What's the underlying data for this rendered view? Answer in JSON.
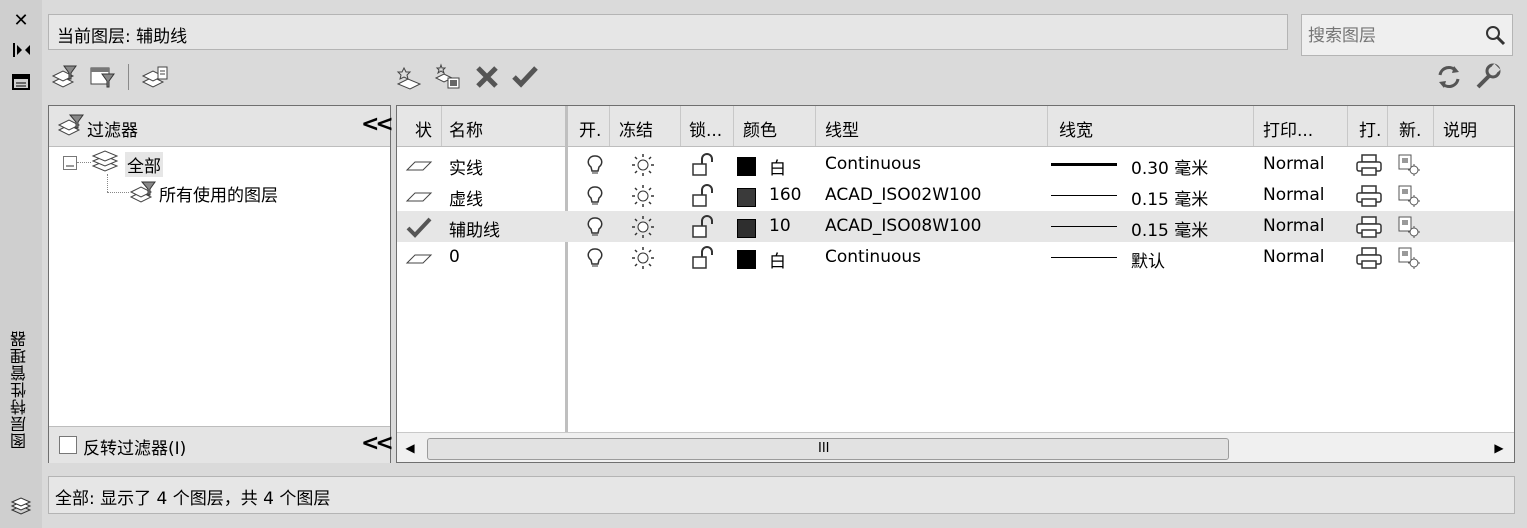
{
  "sidebar": {
    "title": "图层特性管理器",
    "close_icon": "close-icon",
    "autohide_icon": "autohide-icon",
    "properties_icon": "properties-icon",
    "layers_icon": "layers-icon"
  },
  "header": {
    "current_layer_label": "当前图层: 辅助线",
    "search_placeholder": "搜索图层"
  },
  "filter_panel": {
    "title": "过滤器",
    "tree": {
      "root": "全部",
      "child": "所有使用的图层"
    },
    "invert_label": "反转过滤器(I)",
    "invert_checked": false
  },
  "layer_table": {
    "columns": [
      "状",
      "名称",
      "开.",
      "冻结",
      "锁...",
      "颜色",
      "线型",
      "线宽",
      "打印...",
      "打.",
      "新.",
      "说明"
    ],
    "rows": [
      {
        "status": "layer",
        "name": "实线",
        "on": true,
        "frozen": false,
        "locked": false,
        "color_swatch": "#000000",
        "color": "白",
        "linetype": "Continuous",
        "lineweight": "0.30 毫米",
        "plot_style": "Normal"
      },
      {
        "status": "layer",
        "name": "虚线",
        "on": true,
        "frozen": false,
        "locked": false,
        "color_swatch": "#3a3a3a",
        "color": "160",
        "linetype": "ACAD_ISO02W100",
        "lineweight": "0.15 毫米",
        "plot_style": "Normal"
      },
      {
        "status": "current",
        "name": "辅助线",
        "on": true,
        "frozen": false,
        "locked": false,
        "color_swatch": "#2e2e2e",
        "color": "10",
        "linetype": "ACAD_ISO08W100",
        "lineweight": "0.15 毫米",
        "plot_style": "Normal"
      },
      {
        "status": "layer",
        "name": "0",
        "on": true,
        "frozen": false,
        "locked": false,
        "color_swatch": "#000000",
        "color": "白",
        "linetype": "Continuous",
        "lineweight": "默认",
        "plot_style": "Normal"
      }
    ],
    "scroll_grip": "III"
  },
  "status_bar": {
    "text": "全部: 显示了 4 个图层，共 4 个图层"
  },
  "colors": {
    "selected_row": "#e6e6e6",
    "panel_bg": "#dadada"
  }
}
